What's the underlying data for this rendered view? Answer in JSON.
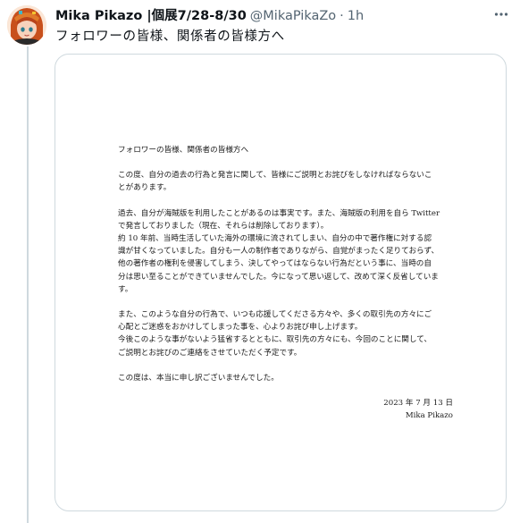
{
  "tweet": {
    "author": {
      "display_name": "Mika Pikazo |個展7/28-8/30",
      "handle": "@MikaPikaZo",
      "separator": "·",
      "time": "1h"
    },
    "text": "フォロワーの皆様、関係者の皆様方へ",
    "more_icon": "more-horizontal-icon",
    "thread_line_color": "#cfd9de"
  },
  "letter": {
    "salutation": "フォロワーの皆様、関係者の皆様方へ",
    "para1": [
      "この度、自分の過去の行為と発言に関して、皆様にご説明とお詫びをしなければならないこ",
      "とがあります。"
    ],
    "para2": [
      "過去、自分が海賊版を利用したことがあるのは事実です。また、海賊版の利用を自ら Twitter",
      "で発言しておりました（現在、それらは削除しております）。",
      "約 10 年前、当時生活していた海外の環境に流されてしまい、自分の中で著作権に対する認",
      "識が甘くなっていました。自分も一人の制作者でありながら、自覚がまったく足りておらず、",
      "他の著作者の権利を侵害してしまう、決してやってはならない行為だという事に、当時の自",
      "分は思い至ることができていませんでした。今になって思い返して、改めて深く反省していま",
      "す。"
    ],
    "para3": [
      "また、このような自分の行為で、いつも応援してくださる方々や、多くの取引先の方々にご",
      "心配とご迷惑をおかけしてしまった事を、心よりお詫び申し上げます。",
      "今後このような事がないよう猛省するとともに、取引先の方々にも、今回のことに関して、",
      "ご説明とお詫びのご連絡をさせていただく予定です。"
    ],
    "closing": "この度は、本当に申し訳ございませんでした。",
    "date": "2023 年 7 月 13 日",
    "signature": "Mika Pikazo"
  }
}
